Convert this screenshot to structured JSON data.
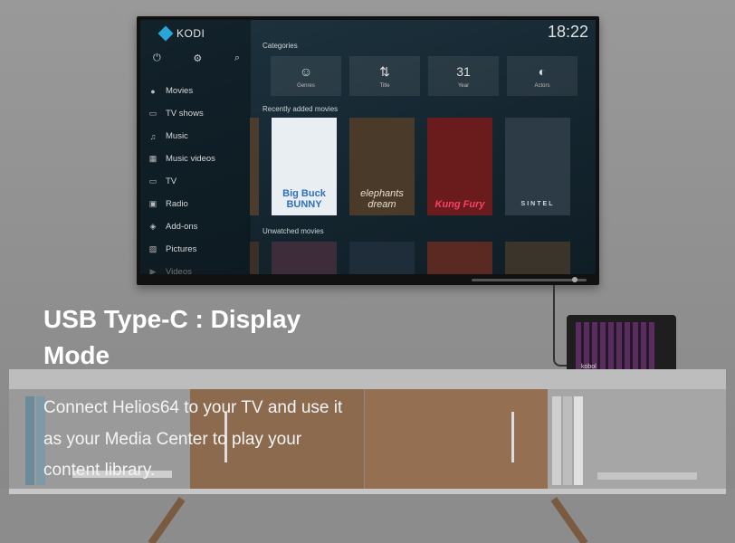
{
  "tv": {
    "app_name": "KODI",
    "clock": "18:22",
    "tools": [
      "power-icon",
      "gear-icon",
      "search-icon"
    ],
    "menu": [
      {
        "label": "Movies",
        "icon": "people-icon"
      },
      {
        "label": "TV shows",
        "icon": "monitor-icon"
      },
      {
        "label": "Music",
        "icon": "headphones-icon"
      },
      {
        "label": "Music videos",
        "icon": "film-icon"
      },
      {
        "label": "TV",
        "icon": "tv-icon"
      },
      {
        "label": "Radio",
        "icon": "radio-icon"
      },
      {
        "label": "Add-ons",
        "icon": "box-icon"
      },
      {
        "label": "Pictures",
        "icon": "image-icon"
      },
      {
        "label": "Videos",
        "icon": "video-icon"
      }
    ],
    "categories_heading": "Categories",
    "categories": [
      {
        "label": "Genres",
        "icon": "masks-icon"
      },
      {
        "label": "Title",
        "icon": "sort-az-icon"
      },
      {
        "label": "Year",
        "icon": "calendar-icon"
      },
      {
        "label": "Actors",
        "icon": "mask-icon"
      }
    ],
    "calendar_day": "31",
    "recent_heading": "Recently added movies",
    "posters": [
      {
        "title": "Big Buck BUNNY",
        "bg": "#e9eef2",
        "fg": "#2f6fc0"
      },
      {
        "title": "elephants dream",
        "bg": "#4a3a2a",
        "fg": "#e8dfc8"
      },
      {
        "title": "Kung Fury",
        "bg": "#6a1c1c",
        "fg": "#ff3d6a"
      },
      {
        "title": "SINTEL",
        "bg": "#2c3b46",
        "fg": "#cfd8dd"
      }
    ],
    "unwatched_heading": "Unwatched movies"
  },
  "device": {
    "brand": "kobol"
  },
  "overlay": {
    "headline": "USB Type-C : Display Mode",
    "description": "Connect Helios64 to your TV and use it as your Media Center to play your content library."
  },
  "colors": {
    "kodi_accent": "#28a6d8",
    "poster_accent": "#ff3d6a"
  }
}
